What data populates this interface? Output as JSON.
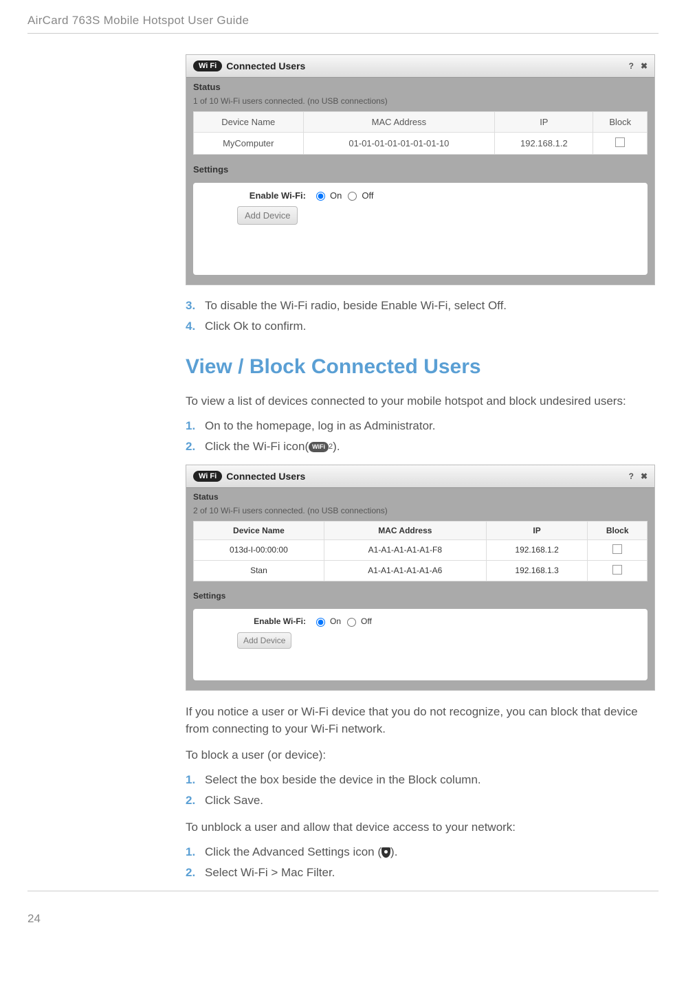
{
  "page": {
    "header": "AirCard 763S Mobile Hotspot User Guide",
    "number": "24"
  },
  "panel1": {
    "wifi_badge": "Wi Fi",
    "title": "Connected Users",
    "help": "?",
    "close": "✖",
    "status_label": "Status",
    "status_text": "1 of 10 Wi-Fi users connected. (no USB connections)",
    "headers": {
      "device": "Device Name",
      "mac": "MAC Address",
      "ip": "IP",
      "block": "Block"
    },
    "rows": [
      {
        "device": "MyComputer",
        "mac": "01-01-01-01-01-01-01-10",
        "ip": "192.168.1.2"
      }
    ],
    "settings_label": "Settings",
    "enable_label": "Enable Wi-Fi:",
    "on": "On",
    "off": "Off",
    "add_device": "Add Device"
  },
  "stepsA": {
    "s3": "To disable the Wi-Fi radio, beside Enable Wi-Fi, select Off.",
    "s4": "Click Ok to confirm."
  },
  "section_heading": "View / Block Connected Users",
  "intro": "To view a list of devices connected to your mobile hotspot and block undesired users:",
  "stepsB": {
    "s1": "On to the homepage, log in as Administrator.",
    "s2a": "Click the Wi-Fi icon(",
    "s2_badge": "WiFi",
    "s2_count": "2",
    "s2b": ")."
  },
  "panel2": {
    "wifi_badge": "Wi Fi",
    "title": "Connected Users",
    "help": "?",
    "close": "✖",
    "status_label": "Status",
    "status_text": "2 of 10 Wi-Fi users connected. (no USB connections)",
    "headers": {
      "device": "Device Name",
      "mac": "MAC Address",
      "ip": "IP",
      "block": "Block"
    },
    "rows": [
      {
        "device": "013d-I-00:00:00",
        "mac": "A1-A1-A1-A1-A1-F8",
        "ip": "192.168.1.2"
      },
      {
        "device": "Stan",
        "mac": "A1-A1-A1-A1-A1-A6",
        "ip": "192.168.1.3"
      }
    ],
    "settings_label": "Settings",
    "enable_label": "Enable Wi-Fi:",
    "on": "On",
    "off": "Off",
    "add_device": "Add Device"
  },
  "after_panel2": "If you notice a user or Wi-Fi device that you do not recognize, you can block that device from connecting to your Wi-Fi network.",
  "block_intro": "To block a user (or device):",
  "stepsC": {
    "s1": "Select the box beside the device in the Block column.",
    "s2": "Click Save."
  },
  "unblock_intro": "To unblock a user and allow that device access to your network:",
  "stepsD": {
    "s1a": "Click the Advanced Settings icon (",
    "s1b": ").",
    "s2": "Select Wi-Fi > Mac Filter."
  }
}
